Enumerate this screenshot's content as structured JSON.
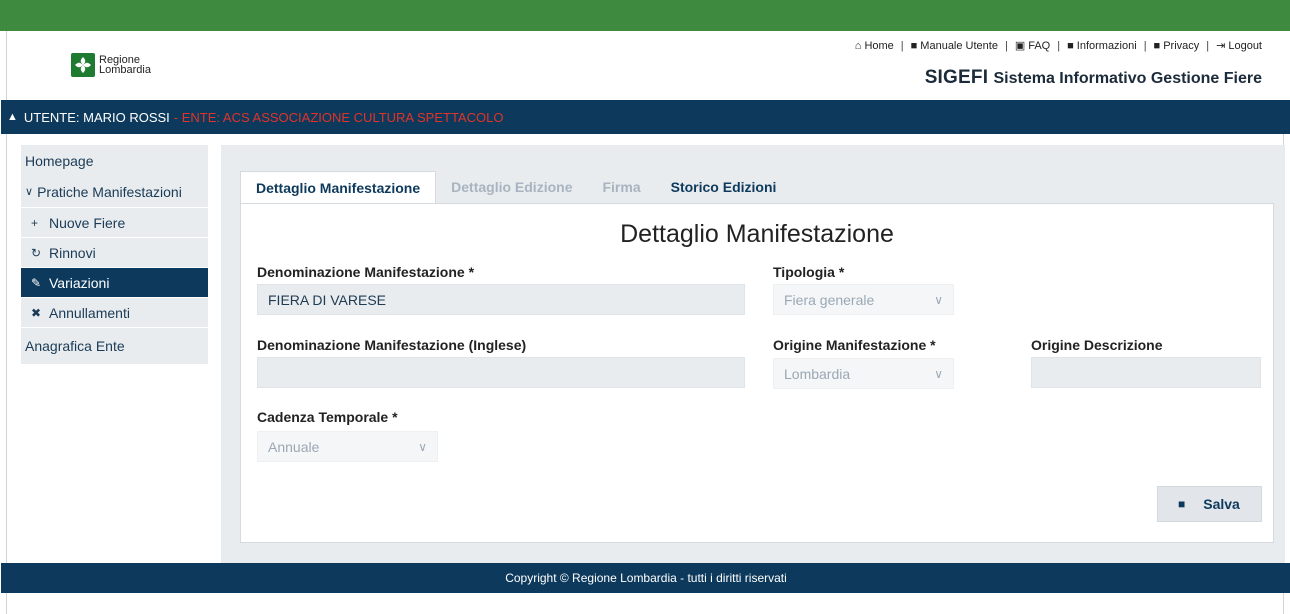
{
  "header": {
    "logo_line1": "Regione",
    "logo_line2": "Lombardia",
    "links": [
      {
        "icon": "home-icon",
        "label": "Home"
      },
      {
        "icon": "document-icon",
        "label": "Manuale Utente"
      },
      {
        "icon": "faq-icon",
        "label": "FAQ"
      },
      {
        "icon": "document-icon",
        "label": "Informazioni"
      },
      {
        "icon": "document-icon",
        "label": "Privacy"
      },
      {
        "icon": "logout-icon",
        "label": "Logout"
      }
    ],
    "app_acronym": "SIGEFI",
    "app_name": "Sistema Informativo Gestione Fiere"
  },
  "userbar": {
    "user": "UTENTE: MARIO ROSSI",
    "ente": "- ENTE: ACS ASSOCIAZIONE CULTURA SPETTACOLO"
  },
  "sidebar": {
    "homepage": "Homepage",
    "group": "Pratiche Manifestazioni",
    "items": [
      {
        "icon": "plus-icon",
        "label": "Nuove Fiere"
      },
      {
        "icon": "refresh-icon",
        "label": "Rinnovi"
      },
      {
        "icon": "pencil-icon",
        "label": "Variazioni"
      },
      {
        "icon": "trash-icon",
        "label": "Annullamenti"
      }
    ],
    "anagrafica": "Anagrafica Ente"
  },
  "tabs": [
    {
      "label": "Dettaglio Manifestazione",
      "state": "active"
    },
    {
      "label": "Dettaglio Edizione",
      "state": "disabled"
    },
    {
      "label": "Firma",
      "state": "disabled"
    },
    {
      "label": "Storico Edizioni",
      "state": "normal"
    }
  ],
  "form": {
    "title": "Dettaglio Manifestazione",
    "denominazione_label": "Denominazione Manifestazione *",
    "denominazione_value": "FIERA DI VARESE",
    "tipologia_label": "Tipologia *",
    "tipologia_value": "Fiera generale",
    "denominazione_en_label": "Denominazione Manifestazione (Inglese)",
    "denominazione_en_value": "",
    "origine_label": "Origine Manifestazione *",
    "origine_value": "Lombardia",
    "origine_descr_label": "Origine Descrizione",
    "origine_descr_value": "",
    "cadenza_label": "Cadenza Temporale *",
    "cadenza_value": "Annuale",
    "save_label": "Salva"
  },
  "footer": {
    "text": "Copyright © Regione Lombardia - tutti i diritti riservati"
  },
  "colors": {
    "topbar": "#3e8a3f",
    "navy": "#0d3a5c",
    "ente_red": "#e0332a"
  }
}
